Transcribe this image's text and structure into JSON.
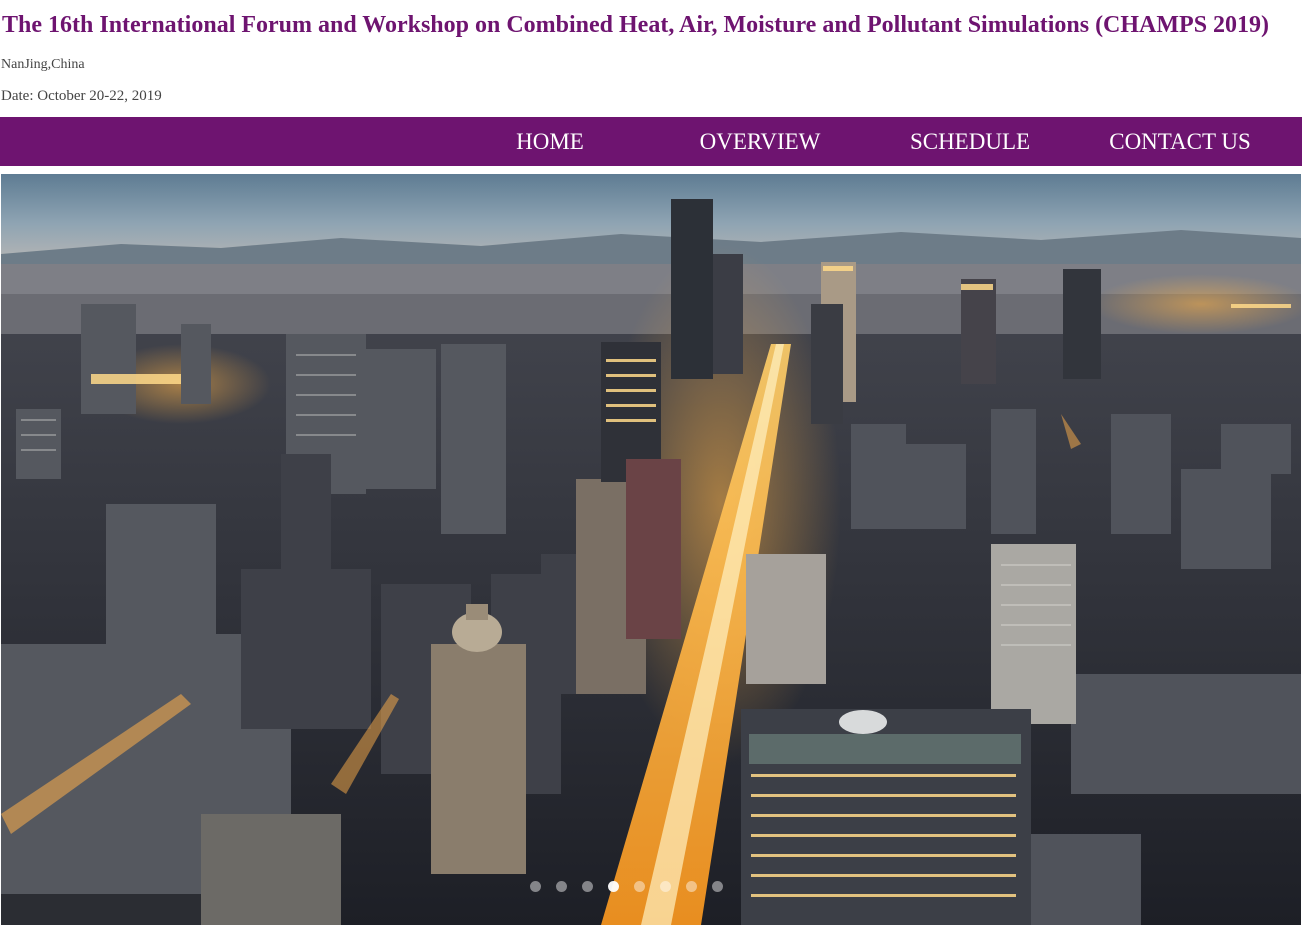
{
  "header": {
    "title": "The 16th International Forum and Workshop on Combined Heat, Air, Moisture and Pollutant Simulations (CHAMPS 2019)",
    "location": "NanJing,China",
    "date": "Date: October 20-22, 2019"
  },
  "nav": {
    "items": [
      {
        "label": "HOME"
      },
      {
        "label": "OVERVIEW"
      },
      {
        "label": "SCHEDULE"
      },
      {
        "label": "CONTACT US"
      }
    ]
  },
  "carousel": {
    "slide_count": 8,
    "active_slide": 4
  },
  "colors": {
    "brand": "#6e1470",
    "nav_text": "#ffffff",
    "body_text": "#444444"
  }
}
